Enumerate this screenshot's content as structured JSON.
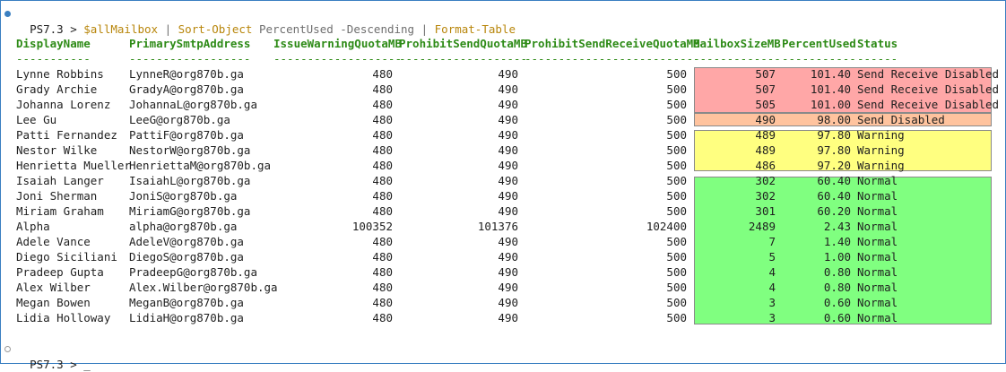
{
  "prompt": {
    "label": "PS7.3 > ",
    "var": "$allMailbox",
    "pipe1": " | ",
    "cmd1": "Sort-Object",
    "arg1": " PercentUsed -Descending",
    "pipe2": " | ",
    "cmd2": "Format-Table"
  },
  "prompt2": {
    "label": "PS7.3 > _"
  },
  "colors": {
    "send_receive_disabled": "#ffa7a7",
    "send_disabled": "#ffc39e",
    "warning": "#ffff80",
    "normal": "#80ff80",
    "header_green": "#2e8b17",
    "frame_blue": "#3a7fc1"
  },
  "table": {
    "headers": [
      "DisplayName",
      "PrimarySmtpAddress",
      "IssueWarningQuotaMB",
      "ProhibitSendQuotaMB",
      "ProhibitSendReceiveQuotaMB",
      "MailboxSizeMB",
      "PercentUsed",
      "Status"
    ],
    "dashes": [
      "-----------",
      "------------------",
      "-------------------",
      "-------------------",
      "--------------------------",
      "-------------",
      "-----------",
      "------"
    ],
    "rows": [
      [
        "Lynne Robbins",
        "LynneR@org870b.ga",
        "480",
        "490",
        "500",
        "507",
        "101.40",
        "Send Receive Disabled"
      ],
      [
        "Grady Archie",
        "GradyA@org870b.ga",
        "480",
        "490",
        "500",
        "507",
        "101.40",
        "Send Receive Disabled"
      ],
      [
        "Johanna Lorenz",
        "JohannaL@org870b.ga",
        "480",
        "490",
        "500",
        "505",
        "101.00",
        "Send Receive Disabled"
      ],
      [
        "Lee Gu",
        "LeeG@org870b.ga",
        "480",
        "490",
        "500",
        "490",
        "98.00",
        "Send Disabled"
      ],
      [
        "Patti Fernandez",
        "PattiF@org870b.ga",
        "480",
        "490",
        "500",
        "489",
        "97.80",
        "Warning"
      ],
      [
        "Nestor Wilke",
        "NestorW@org870b.ga",
        "480",
        "490",
        "500",
        "489",
        "97.80",
        "Warning"
      ],
      [
        "Henrietta Mueller",
        "HenriettaM@org870b.ga",
        "480",
        "490",
        "500",
        "486",
        "97.20",
        "Warning"
      ],
      [
        "Isaiah Langer",
        "IsaiahL@org870b.ga",
        "480",
        "490",
        "500",
        "302",
        "60.40",
        "Normal"
      ],
      [
        "Joni Sherman",
        "JoniS@org870b.ga",
        "480",
        "490",
        "500",
        "302",
        "60.40",
        "Normal"
      ],
      [
        "Miriam Graham",
        "MiriamG@org870b.ga",
        "480",
        "490",
        "500",
        "301",
        "60.20",
        "Normal"
      ],
      [
        "Alpha",
        "alpha@org870b.ga",
        "100352",
        "101376",
        "102400",
        "2489",
        "2.43",
        "Normal"
      ],
      [
        "Adele Vance",
        "AdeleV@org870b.ga",
        "480",
        "490",
        "500",
        "7",
        "1.40",
        "Normal"
      ],
      [
        "Diego Siciliani",
        "DiegoS@org870b.ga",
        "480",
        "490",
        "500",
        "5",
        "1.00",
        "Normal"
      ],
      [
        "Pradeep Gupta",
        "PradeepG@org870b.ga",
        "480",
        "490",
        "500",
        "4",
        "0.80",
        "Normal"
      ],
      [
        "Alex Wilber",
        "Alex.Wilber@org870b.ga",
        "480",
        "490",
        "500",
        "4",
        "0.80",
        "Normal"
      ],
      [
        "Megan Bowen",
        "MeganB@org870b.ga",
        "480",
        "490",
        "500",
        "3",
        "0.60",
        "Normal"
      ],
      [
        "Lidia Holloway",
        "LidiaH@org870b.ga",
        "480",
        "490",
        "500",
        "3",
        "0.60",
        "Normal"
      ]
    ]
  }
}
